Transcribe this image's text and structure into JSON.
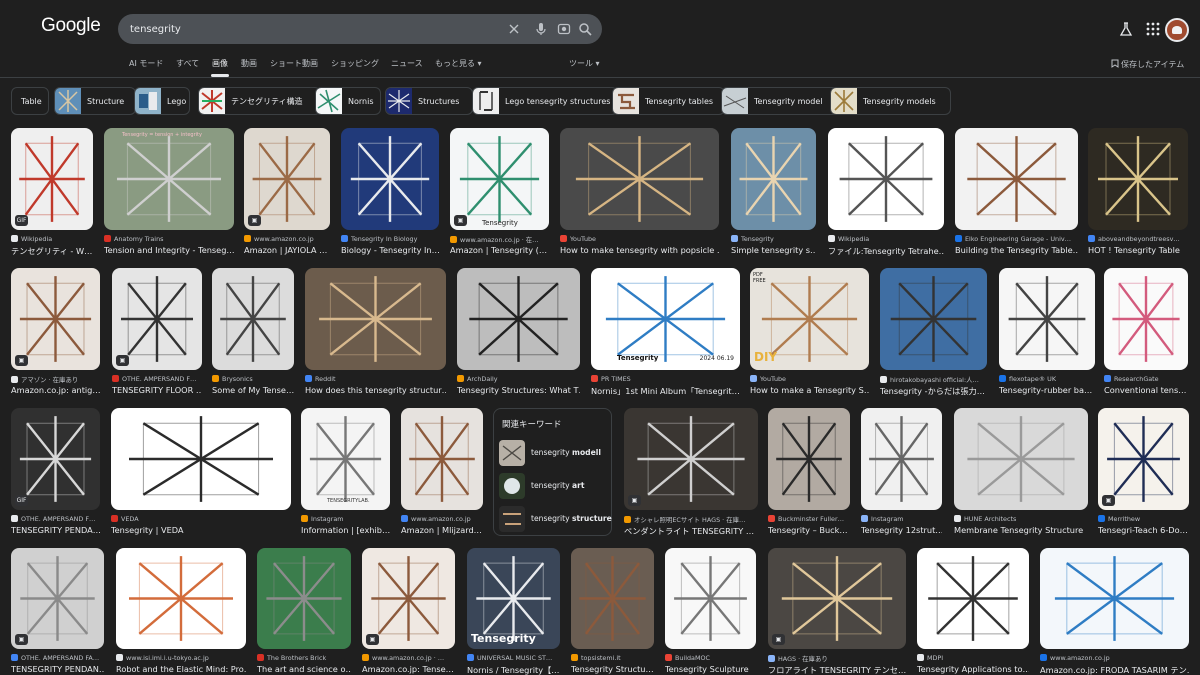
{
  "header": {
    "logo": "Google",
    "search": {
      "value": "tensegrity"
    },
    "labs_icon": "flask-icon",
    "apps_icon": "grid-icon",
    "avatar_icon": "avatar"
  },
  "tabs": [
    "AI モード",
    "すべて",
    "画像",
    "動画",
    "ショート動画",
    "ショッピング",
    "ニュース",
    "もっと見る ▾",
    "ツール ▾"
  ],
  "active_tab": "画像",
  "saved_label": "保存したアイテム",
  "chips": [
    "Table",
    "Structure",
    "Lego",
    "テンセグリティ構造",
    "Nornis",
    "Structures",
    "Lego tensegrity structures",
    "Tensegrity tables",
    "Tensegrity model",
    "Tensegrity models"
  ],
  "related": {
    "heading": "関連キーワード",
    "items": [
      {
        "prefix": "tensegrity ",
        "bold": "modell"
      },
      {
        "prefix": "tensegrity ",
        "bold": "art"
      },
      {
        "prefix": "tensegrity ",
        "bold": "structure"
      }
    ]
  },
  "results": [
    {
      "source": "Wikipedia",
      "title": "テンセグリティ - W…",
      "badge": "GIF"
    },
    {
      "source": "Anatomy Trains",
      "title": "Tension and Integrity - Tenseg…",
      "badge": ""
    },
    {
      "source": "www.amazon.co.jp",
      "title": "Amazon | JAYIOLA …",
      "badge": "▣"
    },
    {
      "source": "Tensegrity In Biology",
      "title": "Biology - Tensegrity In…",
      "badge": ""
    },
    {
      "source": "www.amazon.co.jp · 在…",
      "title": "Amazon | Tensegrity (…",
      "badge": "▣"
    },
    {
      "source": "YouTube",
      "title": "How to make tensegrity with popsicle …",
      "badge": ""
    },
    {
      "source": "Tensegrity",
      "title": "Simple tensegrity s…",
      "badge": ""
    },
    {
      "source": "Wikipedia",
      "title": "ファイル:Tensegrity Tetrahe…",
      "badge": ""
    },
    {
      "source": "Elko Engineering Garage - Univ…",
      "title": "Building the Tensegrity Table…",
      "badge": ""
    },
    {
      "source": "aboveandbeyondtreesv…",
      "title": "HOT ! Tensegrity Table",
      "badge": ""
    },
    {
      "source": "アマゾン · 在庫あり",
      "title": "Amazon.co.jp: antig…",
      "badge": "▣"
    },
    {
      "source": "OTHE. AMPERSAND F…",
      "title": "TENSEGRITY FLOOR …",
      "badge": "▣"
    },
    {
      "source": "Brysonics",
      "title": "Some of My Tense…",
      "badge": ""
    },
    {
      "source": "Reddit",
      "title": "How does this tensegrity structur…",
      "badge": ""
    },
    {
      "source": "ArchDaily",
      "title": "Tensegrity Structures: What T…",
      "badge": ""
    },
    {
      "source": "PR TIMES",
      "title": "Nornis」1st Mini Album「Tensegrit…",
      "badge": ""
    },
    {
      "source": "YouTube",
      "title": "How to make a Tensegrity S…",
      "badge": ""
    },
    {
      "source": "hirotakobayashi official:人…",
      "title": "Tensegrity -からだは張力…",
      "badge": ""
    },
    {
      "source": "flexotape® UK",
      "title": "Tensegrity-rubber ba…",
      "badge": ""
    },
    {
      "source": "ResearchGate",
      "title": "Conventional tens…",
      "badge": ""
    },
    {
      "source": "OTHE. AMPERSAND F…",
      "title": "TENSEGRITY PENDA…",
      "badge": "GIF"
    },
    {
      "source": "VEDA",
      "title": "Tensegrity | VEDA",
      "badge": ""
    },
    {
      "source": "Instagram",
      "title": "Information | [exhib…",
      "badge": ""
    },
    {
      "source": "www.amazon.co.jp",
      "title": "Amazon | Mlijzard…",
      "badge": ""
    },
    {
      "source": "オシャレ照明ECサイト HAGS · 在庫…",
      "title": "ペンダントライト TENSEGRITY …",
      "badge": "▣"
    },
    {
      "source": "Buckminster Fuller…",
      "title": "Tensegrity – Buck…",
      "badge": ""
    },
    {
      "source": "Instagram",
      "title": "Tensegrity 12strut…",
      "badge": ""
    },
    {
      "source": "HUNE Architects",
      "title": "Membrane Tensegrity Structure",
      "badge": ""
    },
    {
      "source": "Merrithew",
      "title": "Tensegri-Teach 6-Do…",
      "badge": "▣"
    },
    {
      "source": "OTHE. AMPERSAND FA…",
      "title": "TENSEGRITY PENDAN…",
      "badge": "▣"
    },
    {
      "source": "www.isi.imi.i.u-tokyo.ac.jp",
      "title": "Robot and the Elastic Mind: Pro…",
      "badge": ""
    },
    {
      "source": "The Brothers Brick",
      "title": "The art and science o…",
      "badge": ""
    },
    {
      "source": "www.amazon.co.jp · …",
      "title": "Amazon.co.jp: Tense…",
      "badge": "▣"
    },
    {
      "source": "UNIVERSAL MUSIC ST…",
      "title": "Nornis / Tensegrity【…",
      "badge": ""
    },
    {
      "source": "topsistemi.it",
      "title": "Tensegrity Structu…",
      "badge": ""
    },
    {
      "source": "BuildaMOC",
      "title": "Tensegrity Sculpture",
      "badge": ""
    },
    {
      "source": "HAGS · 在庫あり",
      "title": "フロアライト TENSEGRITY テンセ…",
      "badge": "▣"
    },
    {
      "source": "MDPI",
      "title": "Tensegrity Applications to…",
      "badge": ""
    },
    {
      "source": "www.amazon.co.jp",
      "title": "Amazon.co.jp: FRODA TASARIM テン…",
      "badge": ""
    }
  ],
  "image_overlay_text": {
    "anatomy_title": "Tensegrity = tension + integrity",
    "nornis_word": "Tensegrity",
    "youtube_diy": "DIY",
    "youtube_pdf": "PDF FREE",
    "tensegritylab": "TENSEGRITYLAB.",
    "amazon_tensegrity": "Tensegrity",
    "prtimes_date": "2024 06.19"
  }
}
